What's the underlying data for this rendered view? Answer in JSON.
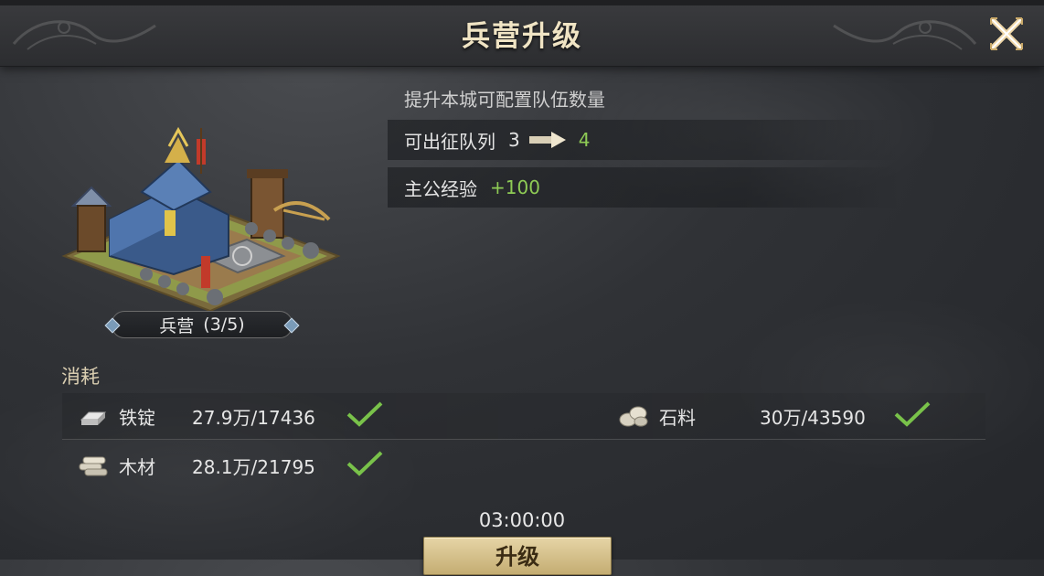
{
  "header": {
    "title": "兵营升级"
  },
  "building": {
    "name": "兵营",
    "level_text": "(3/5)"
  },
  "upgrade": {
    "description": "提升本城可配置队伍数量",
    "march_queue": {
      "label": "可出征队列",
      "from": "3",
      "to": "4"
    },
    "lord_exp": {
      "label": "主公经验",
      "value": "+100"
    }
  },
  "cost": {
    "title": "消耗",
    "items": [
      {
        "name": "铁锭",
        "amount": "27.9万/17436",
        "icon": "iron-ingot-icon",
        "satisfied": true
      },
      {
        "name": "石料",
        "amount": "30万/43590",
        "icon": "stone-icon",
        "satisfied": true
      },
      {
        "name": "木材",
        "amount": "28.1万/21795",
        "icon": "wood-icon",
        "satisfied": true
      }
    ]
  },
  "timer": "03:00:00",
  "upgrade_button": {
    "label": "升级"
  },
  "colors": {
    "accent_green": "#8ecb55",
    "title_gold": "#f0e4c4",
    "button_gold": "#d8c48e"
  }
}
